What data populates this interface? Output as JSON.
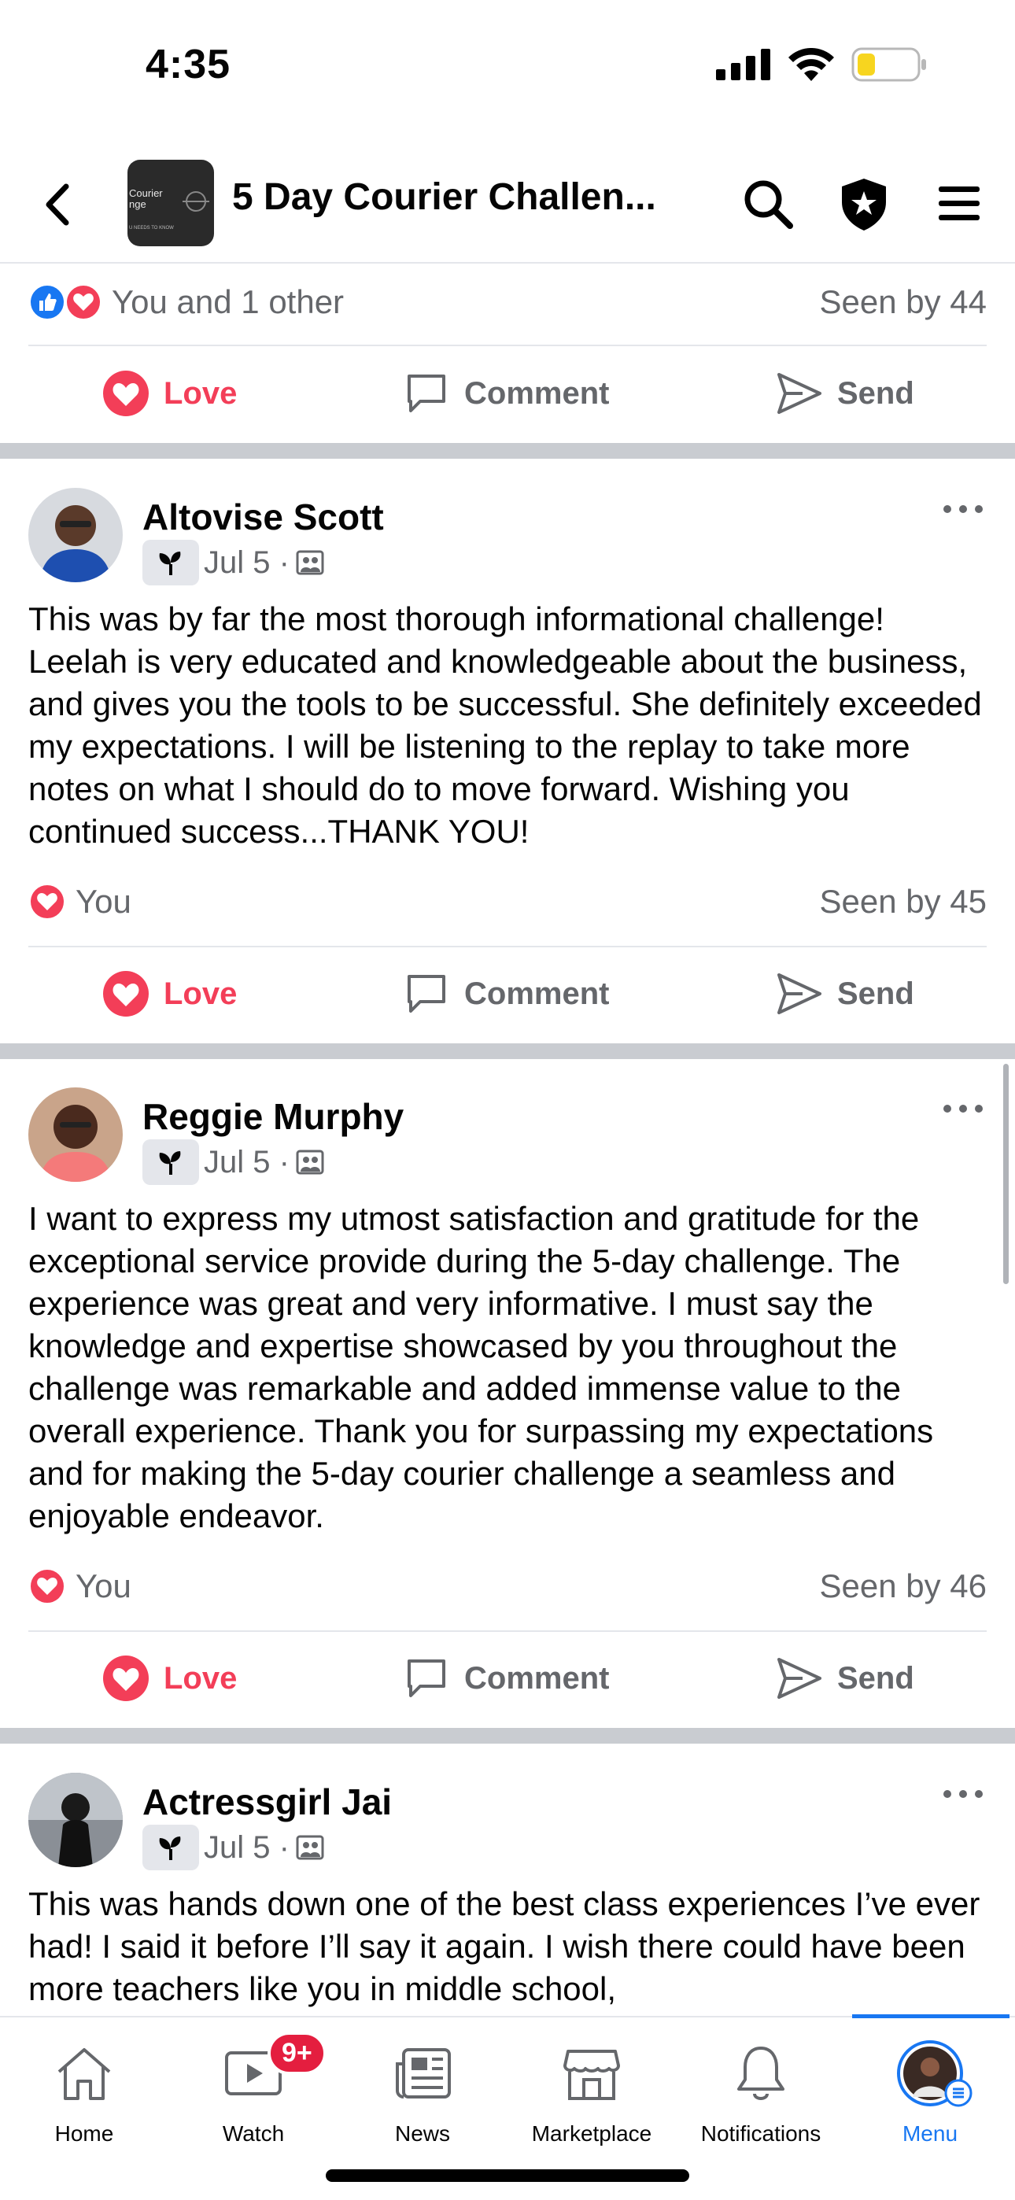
{
  "status_bar": {
    "time": "4:35",
    "battery_color": "#f7d51f"
  },
  "header": {
    "title": "5 Day Courier Challen...",
    "thumb_line1": "Courier\nnge",
    "thumb_line2": "U NEEDS TO KNOW"
  },
  "top_post_footer": {
    "reactions_text": "You and 1 other",
    "seen": "Seen by 44"
  },
  "actions": {
    "love": "Love",
    "comment": "Comment",
    "send": "Send"
  },
  "posts": [
    {
      "author": "Altovise Scott",
      "date": "Jul 5 ·",
      "body": "This was by far the most thorough informational challenge! Leelah is very educated and knowledgeable about the business, and gives you the tools to be successful. She definitely exceeded my expectations. I will be listening to the replay to take more notes on what I should do to move forward. Wishing you continued success...THANK YOU!",
      "reactions_text": "You",
      "seen": "Seen by 45"
    },
    {
      "author": "Reggie Murphy",
      "date": "Jul 5 ·",
      "body": "I want to express my utmost satisfaction and gratitude for the exceptional service provide during the 5-day challenge. The experience was great and very informative. I must say the knowledge and expertise showcased by you throughout the challenge was remarkable and added immense value to the overall experience. Thank you for surpassing my expectations and for making the 5-day courier challenge a seamless and enjoyable endeavor.",
      "reactions_text": "You",
      "seen": "Seen by 46"
    },
    {
      "author": "Actressgirl Jai",
      "date": "Jul 5 ·",
      "body": "This was hands down one of the best class experiences I’ve ever had! I said it before I’ll say it again. I wish there could have been more teachers like you in middle school,"
    }
  ],
  "tabbar": {
    "home": "Home",
    "watch": "Watch",
    "watch_badge": "9+",
    "news": "News",
    "marketplace": "Marketplace",
    "notifications": "Notifications",
    "menu": "Menu"
  },
  "colors": {
    "love": "#f33e58",
    "like": "#1877f2",
    "accent": "#1877f2"
  }
}
